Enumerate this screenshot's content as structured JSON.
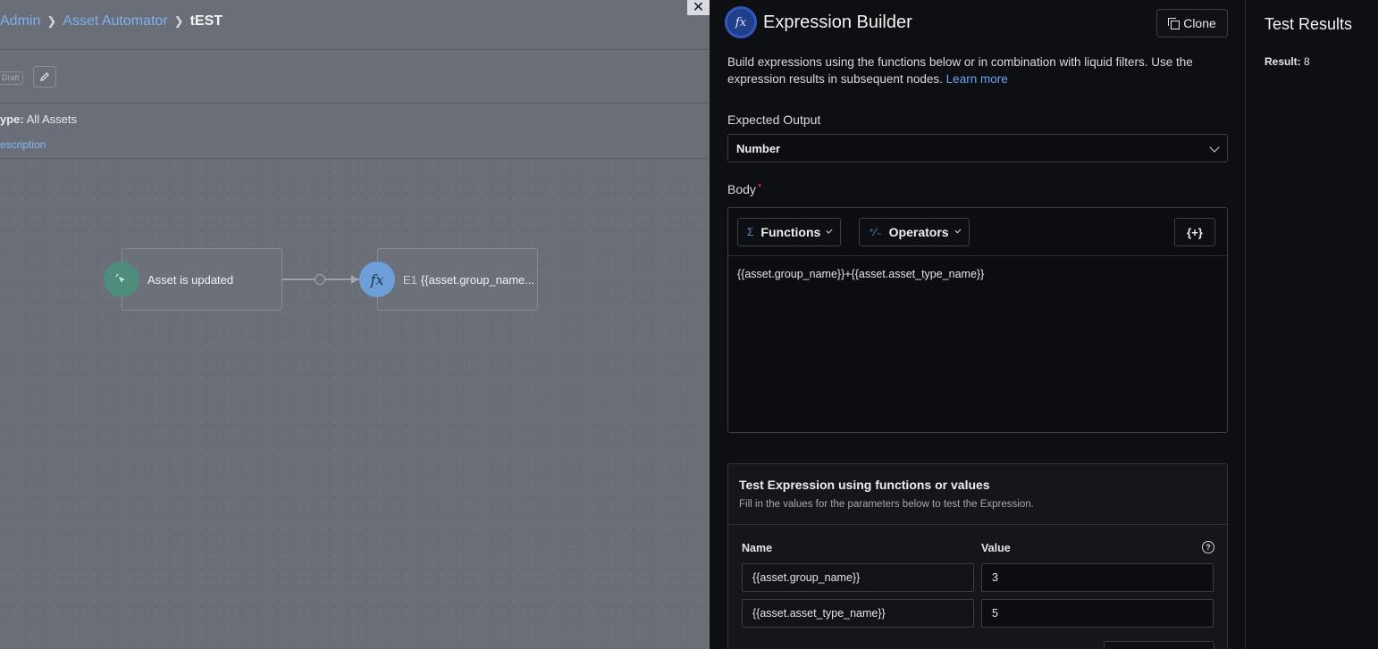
{
  "breadcrumb": {
    "items": [
      "Admin",
      "Asset Automator"
    ],
    "current": "tEST"
  },
  "workflow": {
    "badge": "Draft",
    "type_label": "ype:",
    "type_value": "All Assets",
    "description_link": "escription",
    "nodes": [
      {
        "label": "Asset is updated",
        "icon": "cursor-click-icon"
      },
      {
        "prefix": "E1",
        "label": "{{asset.group_name...",
        "icon": "fx-icon"
      }
    ]
  },
  "panel": {
    "title": "Expression Builder",
    "clone_label": "Clone",
    "intro_text": "Build expressions using the functions below or in combination with liquid filters. Use the expression results in subsequent nodes.",
    "learn_more": "Learn more",
    "expected_output_label": "Expected Output",
    "expected_output_value": "Number",
    "body_label": "Body",
    "required_mark": "*",
    "toolbar": {
      "functions": "Functions",
      "operators": "Operators",
      "insert": "{+}"
    },
    "expression": "{{asset.group_name}}+{{asset.asset_type_name}}",
    "test": {
      "title": "Test Expression using functions or values",
      "subtitle": "Fill in the values for the parameters below to test the Expression.",
      "name_header": "Name",
      "value_header": "Value",
      "rows": [
        {
          "name": "{{asset.group_name}}",
          "value": "3"
        },
        {
          "name": "{{asset.asset_type_name}}",
          "value": "5"
        }
      ]
    }
  },
  "results": {
    "title": "Test Results",
    "label": "Result:",
    "value": "8"
  },
  "colors": {
    "accent": "#6aa4f5",
    "canvas": "#6a6e76",
    "panel": "#0e0f12",
    "required": "#e5484d"
  }
}
